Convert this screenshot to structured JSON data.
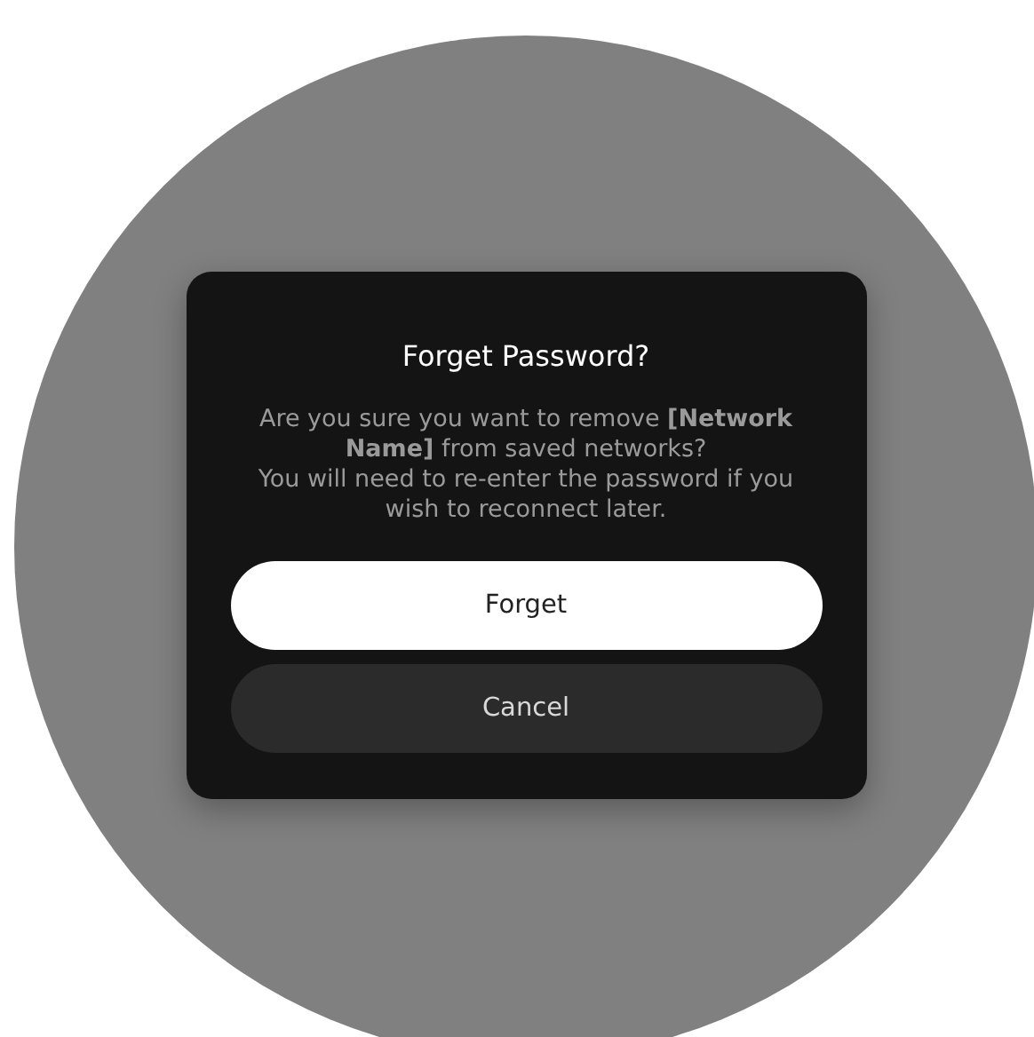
{
  "dialog": {
    "title": "Forget Password?",
    "message": [
      "Are you sure you want to remove **[Network Name]** from saved networks?",
      "You will need to re-enter the password if you wish to reconnect later."
    ],
    "buttons": [
      {
        "label": "Forget",
        "kind": "primary"
      },
      {
        "label": "Cancel",
        "kind": "secondary"
      }
    ]
  }
}
